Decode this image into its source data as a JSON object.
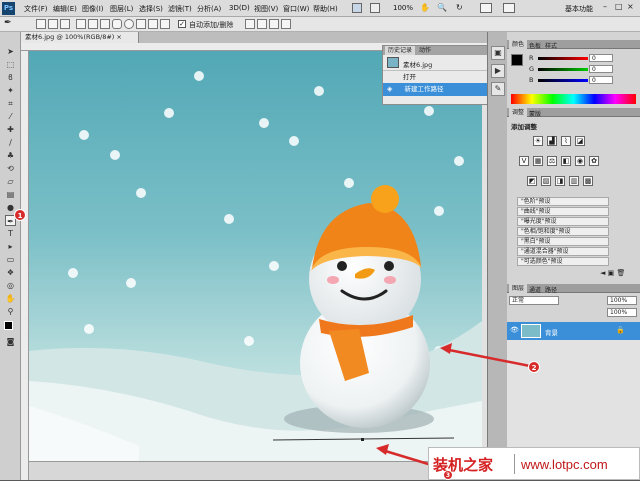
{
  "menubar": {
    "logo": "Ps",
    "items": [
      "文件(F)",
      "编辑(E)",
      "图像(I)",
      "图层(L)",
      "选择(S)",
      "滤镜(T)",
      "分析(A)",
      "3D(D)",
      "视图(V)",
      "窗口(W)",
      "帮助(H)"
    ],
    "zoom": "100%",
    "workspace": "基本功能"
  },
  "options": {
    "auto_delete": "自动添加/删除"
  },
  "document": {
    "tab": "素材6.jpg @ 100%(RGB/8#) ×"
  },
  "history": {
    "tabs": [
      "历史记录",
      "动作"
    ],
    "snapshot": "素材6.jpg",
    "rows": [
      "打开",
      "新建工作路径"
    ]
  },
  "color_panel": {
    "tabs": [
      "颜色",
      "色板",
      "样式"
    ],
    "channels": [
      {
        "label": "R",
        "value": "0"
      },
      {
        "label": "G",
        "value": "0"
      },
      {
        "label": "B",
        "value": "0"
      }
    ]
  },
  "adjust_panel": {
    "tabs": [
      "调整",
      "蒙版"
    ],
    "title": "添加调整",
    "presets": [
      "\"色阶\"预设",
      "\"曲线\"预设",
      "\"曝光度\"预设",
      "\"色相/饱和度\"预设",
      "\"黑白\"预设",
      "\"通道混合器\"预设",
      "\"可选颜色\"预设"
    ]
  },
  "layers_panel": {
    "tabs": [
      "图层",
      "通道",
      "路径"
    ],
    "blend": "正常",
    "opacity": "100%",
    "fill": "100%",
    "layer_name": "背景"
  },
  "annotations": [
    "1",
    "2",
    "3"
  ],
  "watermark": {
    "cn": "装机之家",
    "url": "www.lotpc.com"
  },
  "colors": {
    "accent": "#3a8fd8",
    "badge": "#d72b2b",
    "sky": "#5aacb8",
    "hat": "#f07f1a"
  }
}
